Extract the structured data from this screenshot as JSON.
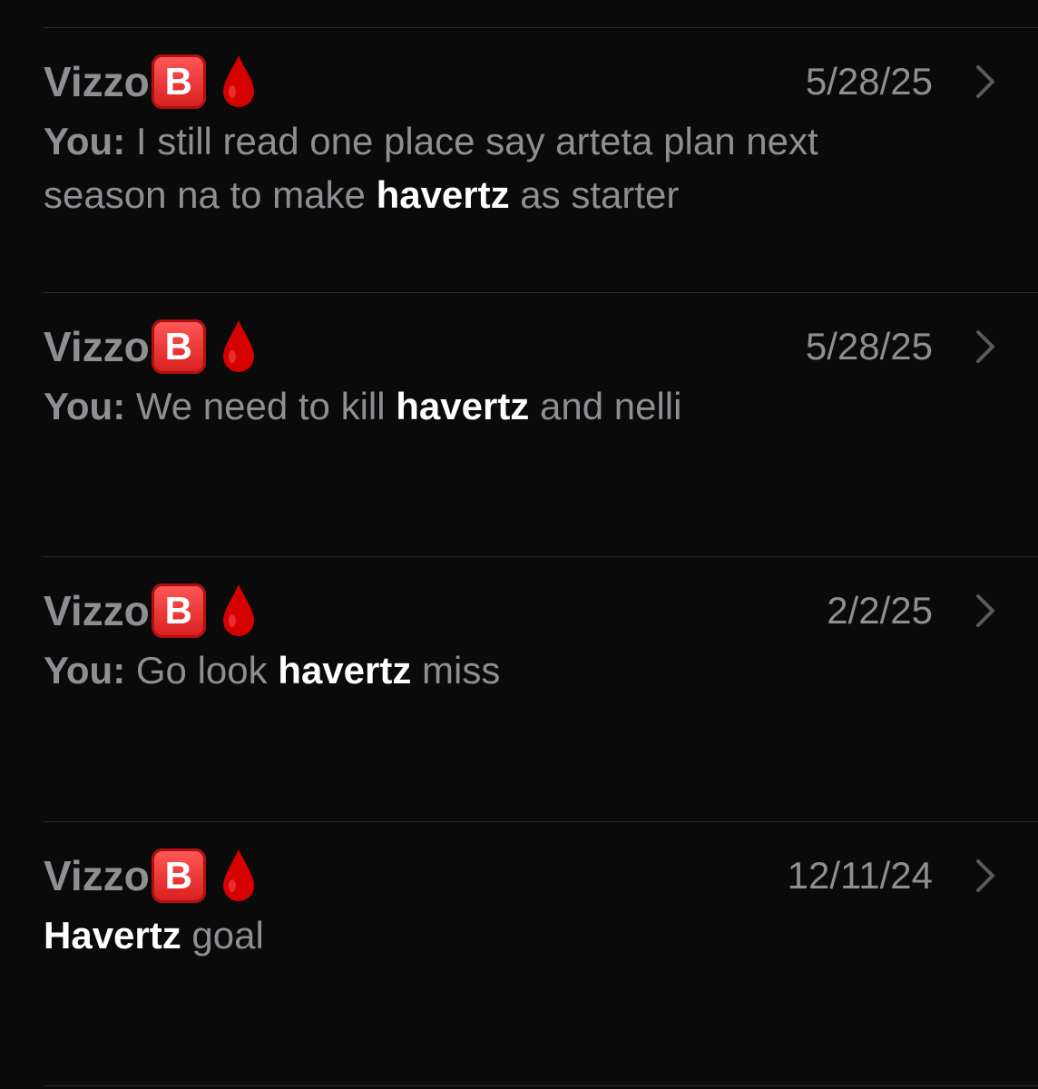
{
  "conversations": [
    {
      "sender": "Vizzo",
      "badge": "B",
      "date": "5/28/25",
      "prefix": "You:",
      "before": " I still read one place say arteta plan next season na to make ",
      "highlight": "havertz",
      "after": " as starter"
    },
    {
      "sender": "Vizzo",
      "badge": "B",
      "date": "5/28/25",
      "prefix": "You:",
      "before": " We need to kill ",
      "highlight": "havertz",
      "after": " and nelli"
    },
    {
      "sender": "Vizzo",
      "badge": "B",
      "date": "2/2/25",
      "prefix": "You:",
      "before": " Go look ",
      "highlight": "havertz",
      "after": " miss"
    },
    {
      "sender": "Vizzo",
      "badge": "B",
      "date": "12/11/24",
      "prefix": "",
      "before": "",
      "highlight": "Havertz",
      "after": " goal"
    }
  ],
  "icons": {
    "drop": "blood-drop-icon",
    "chevron": "chevron-right-icon"
  },
  "colors": {
    "background": "#0a0a0a",
    "secondary_text": "#8e8e93",
    "highlight_text": "#ffffff",
    "badge_red": "#e0245e",
    "drop_red": "#d50000",
    "divider": "#2a2a2c"
  }
}
